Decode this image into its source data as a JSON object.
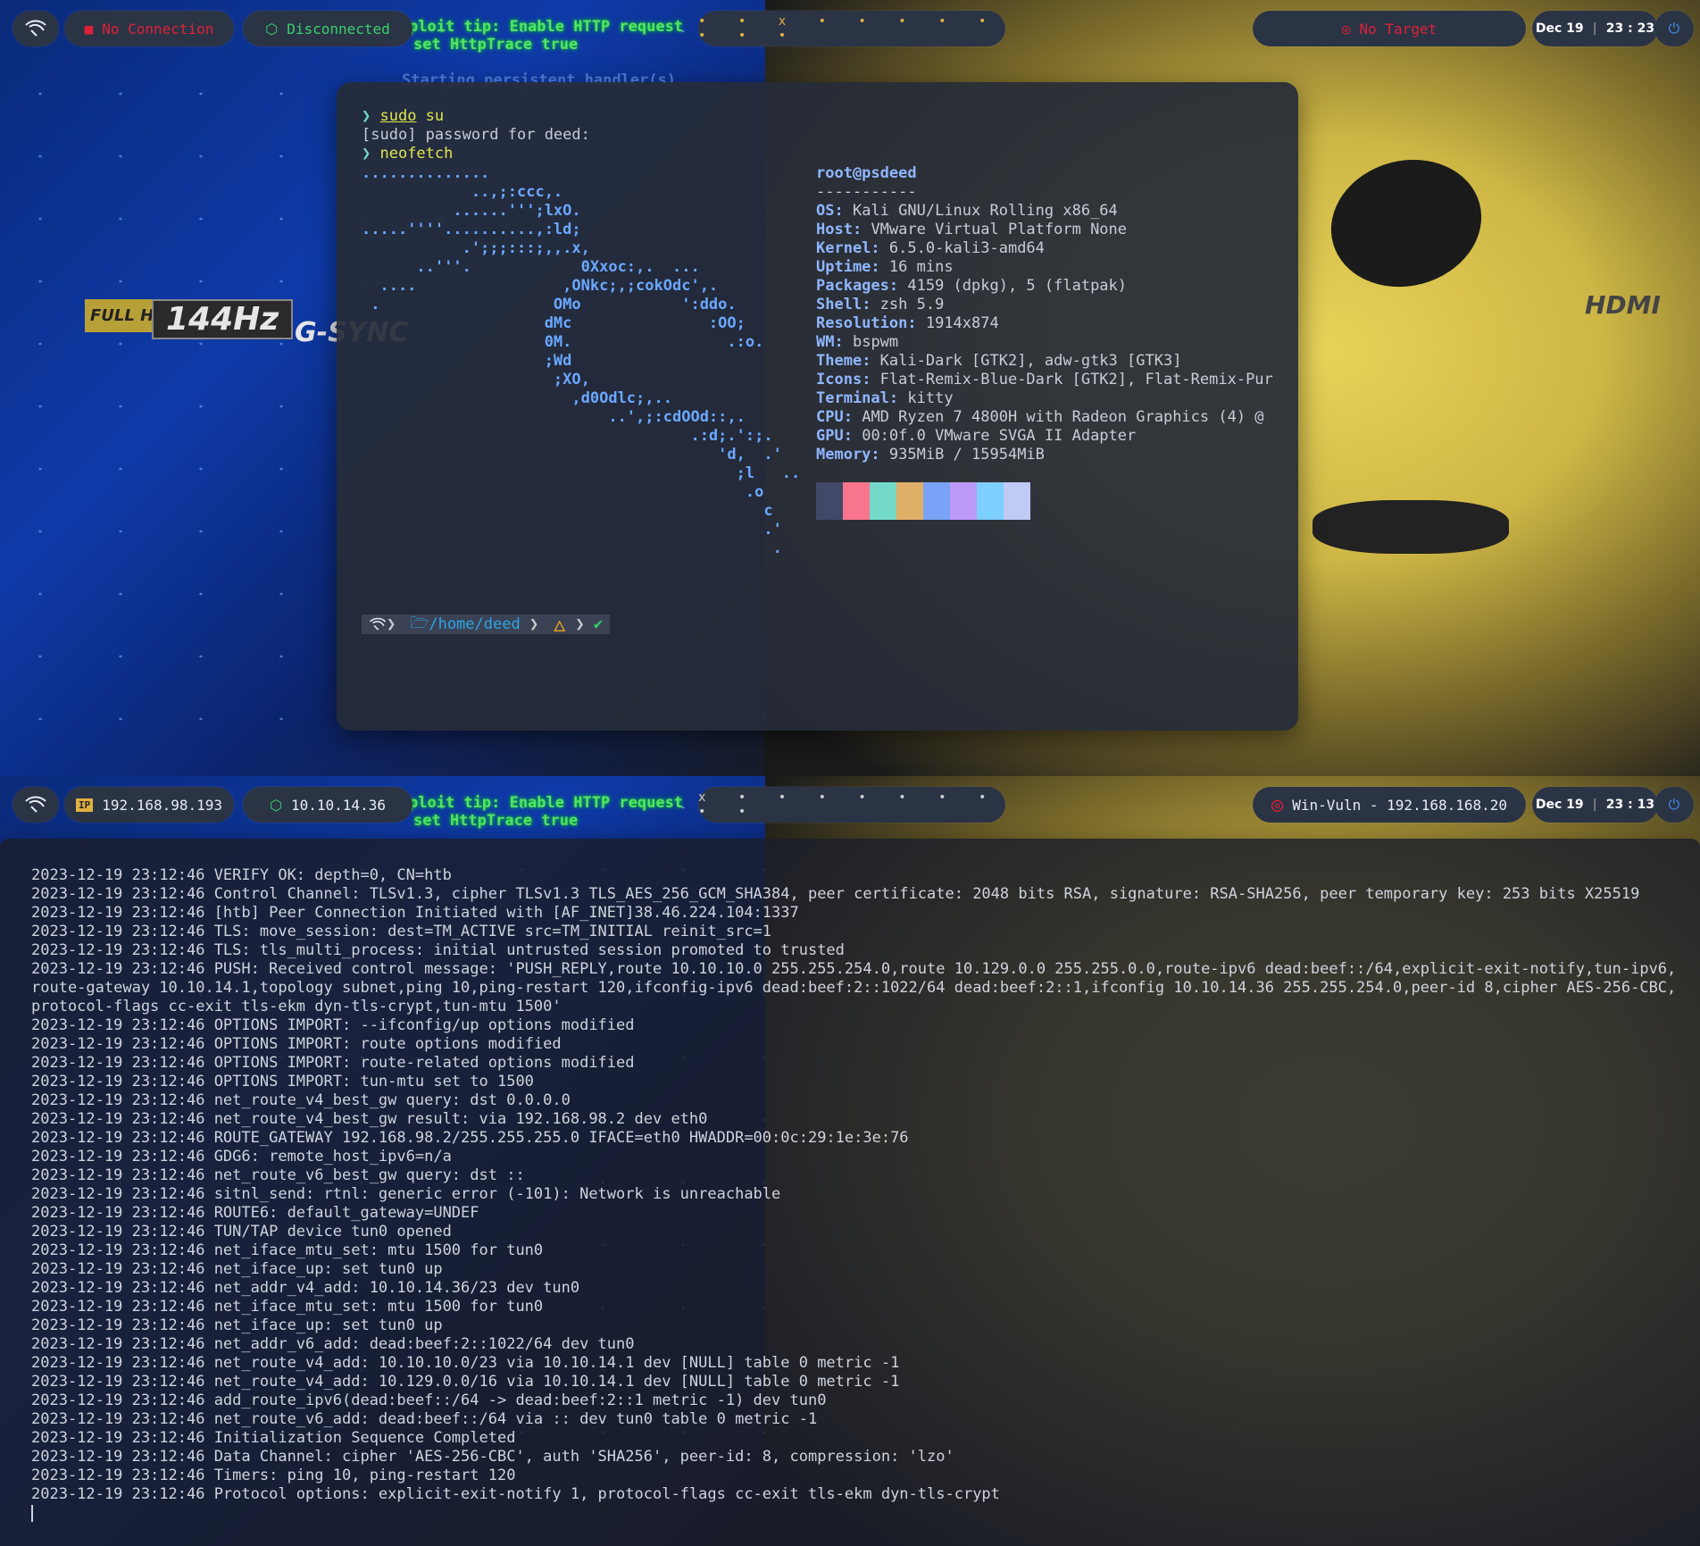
{
  "top": {
    "bar": {
      "connection": "No Connection",
      "vpn": "Disconnected",
      "workspaces": "• • x • • • • • • • •",
      "target": "No Target",
      "date": "Dec 19",
      "time": "23 : 23"
    },
    "overlay_text": [
      "ploit tip: Enable HTTP request",
      "set HttpTrace true",
      "Starting persistent handler(s)..."
    ],
    "terminal": {
      "cmd1_prefix": "❯ ",
      "cmd1_sudo": "sudo",
      "cmd1_rest": " su",
      "sudo_prompt": "[sudo] password for deed:",
      "cmd2_prefix": "❯ ",
      "cmd2": "neofetch",
      "ascii": "..............\n            ..,;:ccc,.\n          ......''';lxO.\n.....''''..........,:ld;\n           .';;;:::;,,.x,\n      ..'''.            0Xxoc:,.  ...\n  ....                ,ONkc;,;cokOdc',.\n .                   OMo           ':ddo.\n                    dMc               :OO;\n                    0M.                 .:o.\n                    ;Wd\n                     ;XO,\n                       ,d0Odlc;,..\n                           ..',;:cdOOd::,.\n                                    .:d;.':;.\n                                       'd,  .'\n                                         ;l   ..\n                                          .o\n                                            c\n                                            .'\n                                             .",
      "user_host": "root@psdeed",
      "separator": "-----------",
      "info": [
        {
          "k": "OS",
          "v": "Kali GNU/Linux Rolling x86_64"
        },
        {
          "k": "Host",
          "v": "VMware Virtual Platform None"
        },
        {
          "k": "Kernel",
          "v": "6.5.0-kali3-amd64"
        },
        {
          "k": "Uptime",
          "v": "16 mins"
        },
        {
          "k": "Packages",
          "v": "4159 (dpkg), 5 (flatpak)"
        },
        {
          "k": "Shell",
          "v": "zsh 5.9"
        },
        {
          "k": "Resolution",
          "v": "1914x874"
        },
        {
          "k": "WM",
          "v": "bspwm"
        },
        {
          "k": "Theme",
          "v": "Kali-Dark [GTK2], adw-gtk3 [GTK3]"
        },
        {
          "k": "Icons",
          "v": "Flat-Remix-Blue-Dark [GTK2], Flat-Remix-Pur"
        },
        {
          "k": "Terminal",
          "v": "kitty"
        },
        {
          "k": "CPU",
          "v": "AMD Ryzen 7 4800H with Radeon Graphics (4) @"
        },
        {
          "k": "GPU",
          "v": "00:0f.0 VMware SVGA II Adapter"
        },
        {
          "k": "Memory",
          "v": "935MiB / 15954MiB"
        }
      ],
      "colors": [
        "#414868",
        "#f7768e",
        "#73daca",
        "#e0af68",
        "#7aa2f7",
        "#bb9af7",
        "#7dcfff",
        "#c0caf5"
      ],
      "prompt_path": "/home/deed",
      "prompt_check": "✔"
    },
    "monitor_labels": {
      "hd": "FULL HD",
      "hz": "144Hz",
      "gsync": "G-SYNC",
      "hdmi": "HDMI"
    }
  },
  "bottom": {
    "bar": {
      "ip": "192.168.98.193",
      "vpn_ip": "10.10.14.36",
      "workspaces": "x • • • • • • • • •",
      "target": "Win-Vuln - 192.168.168.20",
      "date": "Dec 19",
      "time": "23 : 13"
    },
    "log": [
      "2023-12-19 23:12:46 VERIFY OK: depth=0, CN=htb",
      "2023-12-19 23:12:46 Control Channel: TLSv1.3, cipher TLSv1.3 TLS_AES_256_GCM_SHA384, peer certificate: 2048 bits RSA, signature: RSA-SHA256, peer temporary key: 253 bits X25519",
      "2023-12-19 23:12:46 [htb] Peer Connection Initiated with [AF_INET]38.46.224.104:1337",
      "2023-12-19 23:12:46 TLS: move_session: dest=TM_ACTIVE src=TM_INITIAL reinit_src=1",
      "2023-12-19 23:12:46 TLS: tls_multi_process: initial untrusted session promoted to trusted",
      "2023-12-19 23:12:46 PUSH: Received control message: 'PUSH_REPLY,route 10.10.10.0 255.255.254.0,route 10.129.0.0 255.255.0.0,route-ipv6 dead:beef::/64,explicit-exit-notify,tun-ipv6,route-gateway 10.10.14.1,topology subnet,ping 10,ping-restart 120,ifconfig-ipv6 dead:beef:2::1022/64 dead:beef:2::1,ifconfig 10.10.14.36 255.255.254.0,peer-id 8,cipher AES-256-CBC,protocol-flags cc-exit tls-ekm dyn-tls-crypt,tun-mtu 1500'",
      "2023-12-19 23:12:46 OPTIONS IMPORT: --ifconfig/up options modified",
      "2023-12-19 23:12:46 OPTIONS IMPORT: route options modified",
      "2023-12-19 23:12:46 OPTIONS IMPORT: route-related options modified",
      "2023-12-19 23:12:46 OPTIONS IMPORT: tun-mtu set to 1500",
      "2023-12-19 23:12:46 net_route_v4_best_gw query: dst 0.0.0.0",
      "2023-12-19 23:12:46 net_route_v4_best_gw result: via 192.168.98.2 dev eth0",
      "2023-12-19 23:12:46 ROUTE_GATEWAY 192.168.98.2/255.255.255.0 IFACE=eth0 HWADDR=00:0c:29:1e:3e:76",
      "2023-12-19 23:12:46 GDG6: remote_host_ipv6=n/a",
      "2023-12-19 23:12:46 net_route_v6_best_gw query: dst ::",
      "2023-12-19 23:12:46 sitnl_send: rtnl: generic error (-101): Network is unreachable",
      "2023-12-19 23:12:46 ROUTE6: default_gateway=UNDEF",
      "2023-12-19 23:12:46 TUN/TAP device tun0 opened",
      "2023-12-19 23:12:46 net_iface_mtu_set: mtu 1500 for tun0",
      "2023-12-19 23:12:46 net_iface_up: set tun0 up",
      "2023-12-19 23:12:46 net_addr_v4_add: 10.10.14.36/23 dev tun0",
      "2023-12-19 23:12:46 net_iface_mtu_set: mtu 1500 for tun0",
      "2023-12-19 23:12:46 net_iface_up: set tun0 up",
      "2023-12-19 23:12:46 net_addr_v6_add: dead:beef:2::1022/64 dev tun0",
      "2023-12-19 23:12:46 net_route_v4_add: 10.10.10.0/23 via 10.10.14.1 dev [NULL] table 0 metric -1",
      "2023-12-19 23:12:46 net_route_v4_add: 10.129.0.0/16 via 10.10.14.1 dev [NULL] table 0 metric -1",
      "2023-12-19 23:12:46 add_route_ipv6(dead:beef::/64 -> dead:beef:2::1 metric -1) dev tun0",
      "2023-12-19 23:12:46 net_route_v6_add: dead:beef::/64 via :: dev tun0 table 0 metric -1",
      "2023-12-19 23:12:46 Initialization Sequence Completed",
      "2023-12-19 23:12:46 Data Channel: cipher 'AES-256-CBC', auth 'SHA256', peer-id: 8, compression: 'lzo'",
      "2023-12-19 23:12:46 Timers: ping 10, ping-restart 120",
      "2023-12-19 23:12:46 Protocol options: explicit-exit-notify 1, protocol-flags cc-exit tls-ekm dyn-tls-crypt"
    ]
  },
  "icons": {
    "menu": "kali-dragon-icon",
    "no_connection": "disconnected-icon",
    "vpn": "cube-icon",
    "target": "target-icon",
    "ip": "ip-icon",
    "power": "power-icon"
  }
}
